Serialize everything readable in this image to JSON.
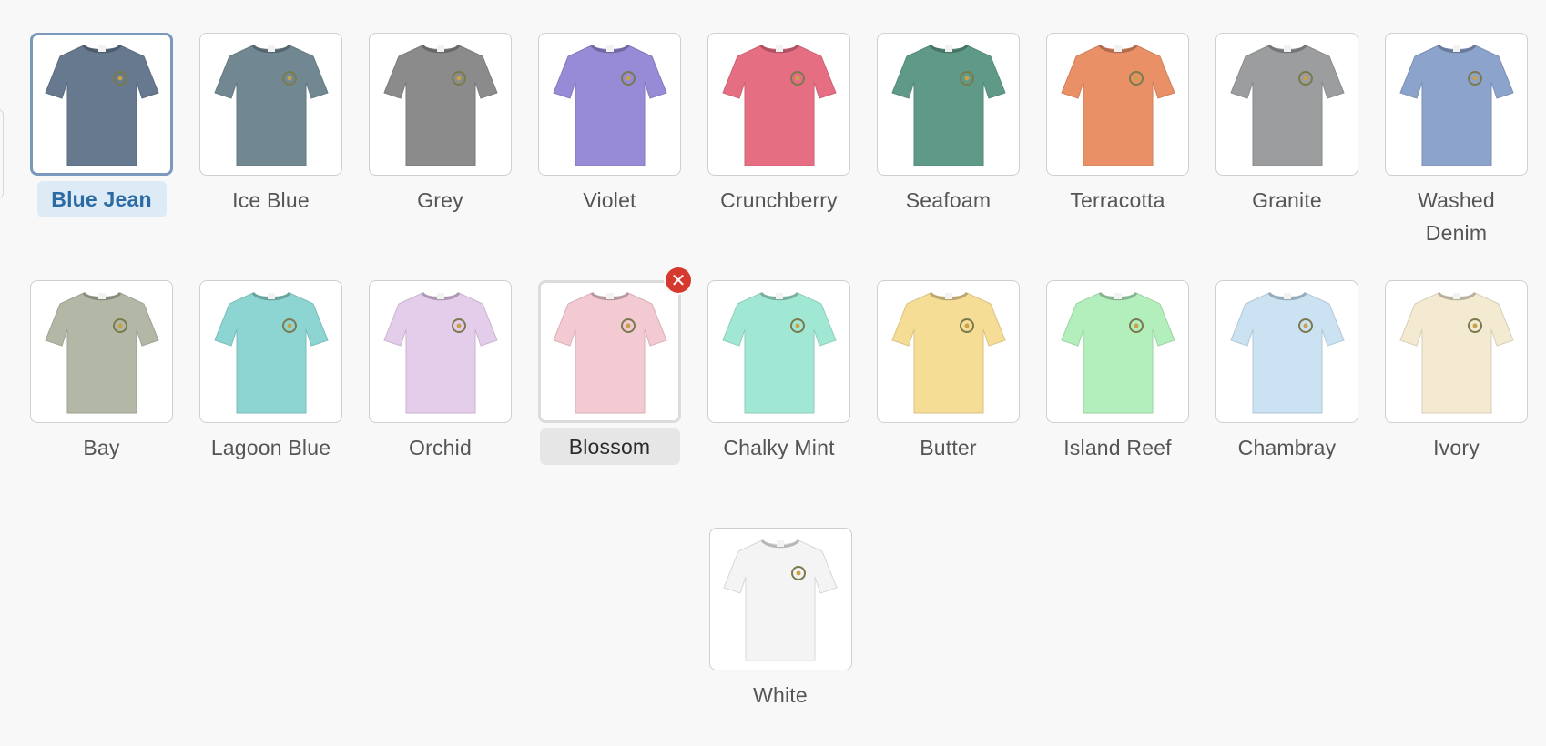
{
  "swatches_row1": [
    {
      "name": "Blue Jean",
      "color": "#66798f",
      "state": "selected"
    },
    {
      "name": "Ice Blue",
      "color": "#718892",
      "state": "normal"
    },
    {
      "name": "Grey",
      "color": "#8b8b8b",
      "state": "normal"
    },
    {
      "name": "Violet",
      "color": "#978ad6",
      "state": "normal"
    },
    {
      "name": "Crunchberry",
      "color": "#e66e82",
      "state": "normal"
    },
    {
      "name": "Seafoam",
      "color": "#5e9a87",
      "state": "normal"
    },
    {
      "name": "Terracotta",
      "color": "#ea9066",
      "state": "normal"
    },
    {
      "name": "Granite",
      "color": "#9b9d9e",
      "state": "normal"
    },
    {
      "name": "Washed Denim",
      "color": "#8ca3cb",
      "state": "normal"
    }
  ],
  "swatches_row2": [
    {
      "name": "Bay",
      "color": "#b2b8a5",
      "state": "normal"
    },
    {
      "name": "Lagoon Blue",
      "color": "#8dd5d3",
      "state": "normal"
    },
    {
      "name": "Orchid",
      "color": "#e4cdeb",
      "state": "normal"
    },
    {
      "name": "Blossom",
      "color": "#f3c9d2",
      "state": "hover",
      "remove_symbol": "✕"
    },
    {
      "name": "Chalky Mint",
      "color": "#a1e8d4",
      "state": "normal"
    },
    {
      "name": "Butter",
      "color": "#f6dd96",
      "state": "normal"
    },
    {
      "name": "Island Reef",
      "color": "#b2efbc",
      "state": "normal"
    },
    {
      "name": "Chambray",
      "color": "#cae2f2",
      "state": "normal"
    },
    {
      "name": "Ivory",
      "color": "#f3ead1",
      "state": "normal"
    }
  ],
  "swatches_row3": [
    {
      "name": "White",
      "color": "#f4f4f4",
      "state": "normal"
    }
  ]
}
